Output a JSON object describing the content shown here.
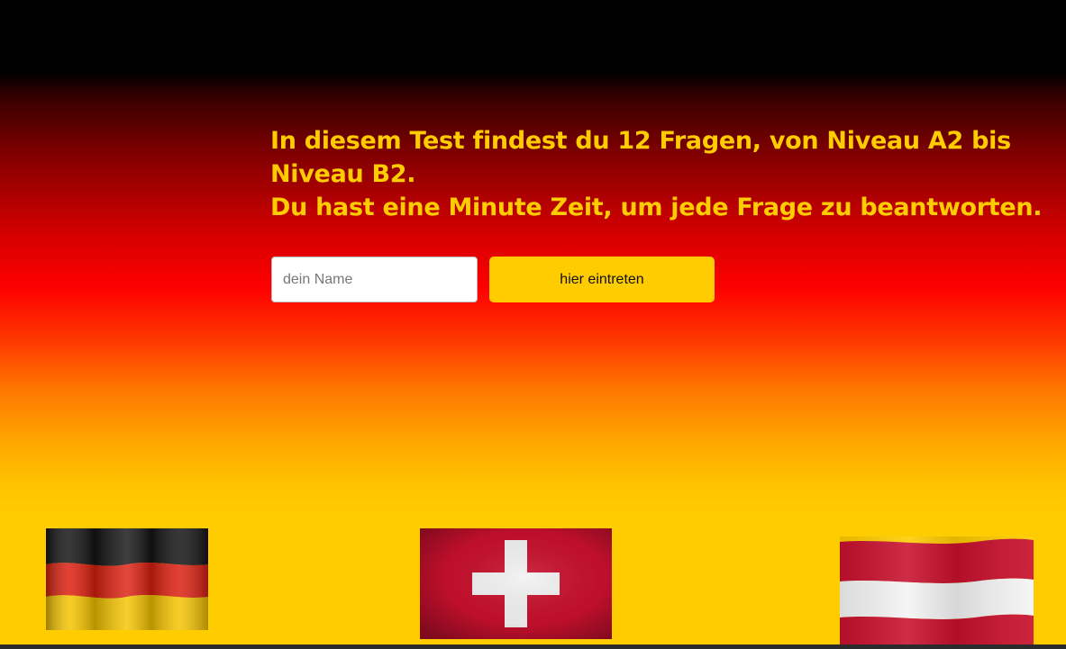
{
  "intro": {
    "line1": "In diesem Test findest du 12 Fragen, von Niveau A2 bis Niveau B2.",
    "line2": "Du hast eine Minute Zeit, um jede Frage zu beantworten."
  },
  "form": {
    "name_placeholder": "dein Name",
    "name_value": "",
    "submit_label": "hier eintreten"
  },
  "flags": {
    "germany": "germany-flag-icon",
    "switzerland": "switzerland-flag-icon",
    "austria": "austria-flag-icon"
  },
  "colors": {
    "accent": "#ffcc00",
    "black": "#000000",
    "red": "#ff0000",
    "gold": "#ffcc00"
  }
}
